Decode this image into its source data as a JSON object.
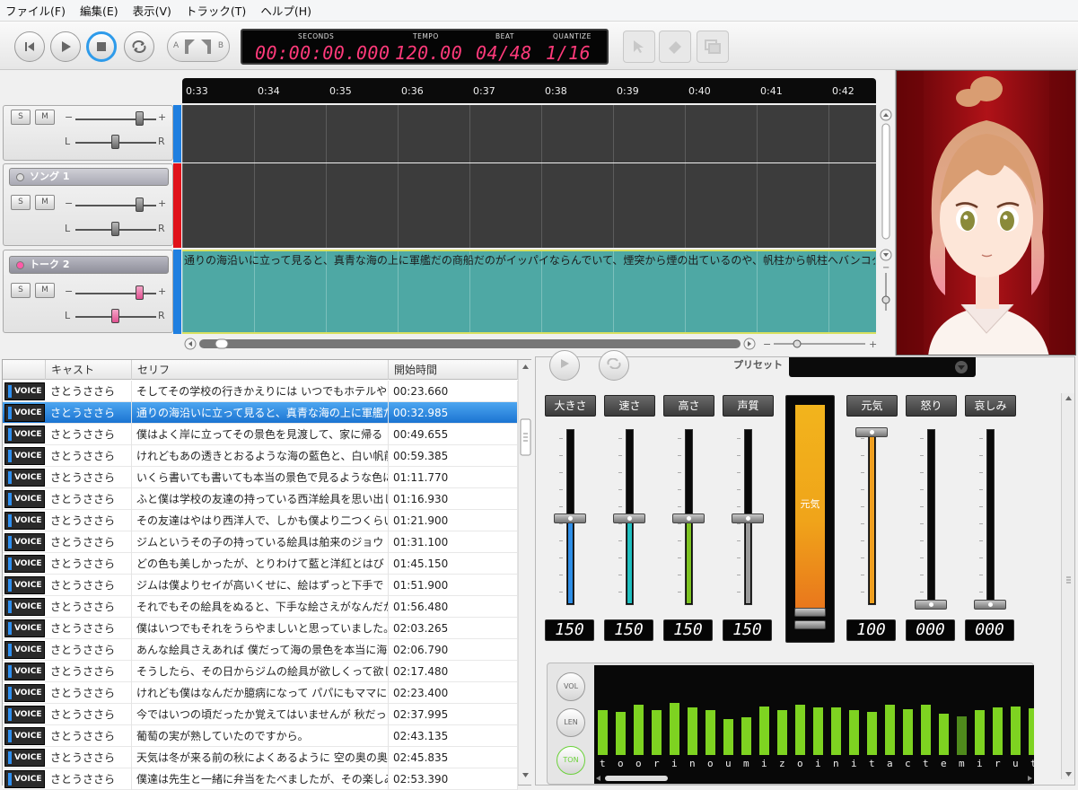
{
  "menu": [
    "ファイル(F)",
    "編集(E)",
    "表示(V)",
    "トラック(T)",
    "ヘルプ(H)"
  ],
  "transport": {
    "seconds_label": "SECONDS",
    "seconds": "00:00:00.000",
    "tempo_label": "TEMPO",
    "tempo": "120.00",
    "beat_label": "BEAT",
    "beat": "04/48",
    "quantize_label": "QUANTIZE",
    "quantize": "1/16",
    "ab_a": "A",
    "ab_b": "B"
  },
  "ruler": [
    "0:33",
    "0:34",
    "0:35",
    "0:36",
    "0:37",
    "0:38",
    "0:39",
    "0:40",
    "0:41",
    "0:42"
  ],
  "tracks": [
    {
      "name": "",
      "solo": "S",
      "mute": "M",
      "l": "L",
      "r": "R",
      "color": "#1f7fe0"
    },
    {
      "name": "ソング 1",
      "solo": "S",
      "mute": "M",
      "l": "L",
      "r": "R",
      "color": "#e0121a"
    },
    {
      "name": "トーク 2",
      "solo": "S",
      "mute": "M",
      "l": "L",
      "r": "R",
      "color": "#1f7fe0"
    }
  ],
  "talk_text": "通りの海沿いに立って見ると、真青な海の上に軍艦だの商船だのがイッパイならんでいて、煙突から煙の出ているのや、帆柱から帆柱へバンコク",
  "list": {
    "headers": {
      "cast": "キャスト",
      "line": "セリフ",
      "start": "開始時間"
    },
    "voice_label": "VOICE",
    "rows": [
      {
        "cast": "さとうささら",
        "line": "そしてその学校の行きかえりには いつでもホテルや",
        "start": "00:23.660"
      },
      {
        "cast": "さとうささら",
        "line": "通りの海沿いに立って見ると、真青な海の上に軍艦だ",
        "start": "00:32.985"
      },
      {
        "cast": "さとうささら",
        "line": "僕はよく岸に立ってその景色を見渡して、家に帰る",
        "start": "00:49.655"
      },
      {
        "cast": "さとうささら",
        "line": "けれどもあの透きとおるような海の藍色と、白い帆前",
        "start": "00:59.385"
      },
      {
        "cast": "さとうささら",
        "line": "いくら書いても書いても本当の景色で見るような色に",
        "start": "01:11.770"
      },
      {
        "cast": "さとうささら",
        "line": "ふと僕は学校の友達の持っている西洋絵具を思い出し",
        "start": "01:16.930"
      },
      {
        "cast": "さとうささら",
        "line": "その友達はやはり西洋人で、しかも僕より二つくらい",
        "start": "01:21.900"
      },
      {
        "cast": "さとうささら",
        "line": "ジムというその子の持っている絵具は舶来のジョウ",
        "start": "01:31.100"
      },
      {
        "cast": "さとうささら",
        "line": "どの色も美しかったが、とりわけて藍と洋紅とはび",
        "start": "01:45.150"
      },
      {
        "cast": "さとうささら",
        "line": "ジムは僕よりセイが高いくせに、絵はずっと下手で",
        "start": "01:51.900"
      },
      {
        "cast": "さとうささら",
        "line": "それでもその絵具をぬると、下手な絵さえがなんだか",
        "start": "01:56.480"
      },
      {
        "cast": "さとうささら",
        "line": "僕はいつでもそれをうらやましいと思っていました。",
        "start": "02:03.265"
      },
      {
        "cast": "さとうささら",
        "line": "あんな絵具さえあれば 僕だって海の景色を本当に海",
        "start": "02:06.790"
      },
      {
        "cast": "さとうささら",
        "line": "そうしたら、その日からジムの絵具が欲しくって欲し",
        "start": "02:17.480"
      },
      {
        "cast": "さとうささら",
        "line": "けれども僕はなんだか臆病になって パパにもママに",
        "start": "02:23.400"
      },
      {
        "cast": "さとうささら",
        "line": "今ではいつの頃だったか覚えてはいませんが 秋だっ",
        "start": "02:37.995"
      },
      {
        "cast": "さとうささら",
        "line": "葡萄の実が熟していたのですから。",
        "start": "02:43.135"
      },
      {
        "cast": "さとうささら",
        "line": "天気は冬が来る前の秋によくあるように 空の奥の奥",
        "start": "02:45.835"
      },
      {
        "cast": "さとうささら",
        "line": "僕達は先生と一緒に弁当をたべましたが、その楽しみ",
        "start": "02:53.390"
      }
    ]
  },
  "panel": {
    "preset_label": "プリセット",
    "sliders": [
      {
        "label": "大きさ",
        "value": "150",
        "level": 0.5,
        "color": "#2f8fe8"
      },
      {
        "label": "速さ",
        "value": "150",
        "level": 0.5,
        "color": "#20c0c0"
      },
      {
        "label": "高さ",
        "value": "150",
        "level": 0.5,
        "color": "#7ec322"
      },
      {
        "label": "声質",
        "value": "150",
        "level": 0.5,
        "color": "#9a9a9a"
      }
    ],
    "emotion_big_label": "元気",
    "emotions": [
      {
        "label": "元気",
        "value": "100",
        "level": 1.0,
        "color": "#f0a020"
      },
      {
        "label": "怒り",
        "value": "000",
        "level": 0.0,
        "color": "#888888"
      },
      {
        "label": "哀しみ",
        "value": "000",
        "level": 0.0,
        "color": "#888888"
      }
    ],
    "wave_buttons": [
      "VOL",
      "LEN",
      "TON"
    ],
    "phonemes": [
      "t",
      "o",
      "o",
      "r",
      "i",
      "n",
      "o",
      "u",
      "m",
      "i",
      "z",
      "o",
      "i",
      "n",
      "i",
      "t",
      "a",
      "c",
      "t",
      "e",
      "m",
      "i",
      "r",
      "u",
      "t"
    ],
    "bar_levels": [
      0.62,
      0.6,
      0.7,
      0.62,
      0.72,
      0.66,
      0.63,
      0.5,
      0.52,
      0.68,
      0.62,
      0.7,
      0.66,
      0.66,
      0.62,
      0.6,
      0.7,
      0.64,
      0.7,
      0.58,
      0.54,
      0.62,
      0.66,
      0.68,
      0.65
    ]
  }
}
